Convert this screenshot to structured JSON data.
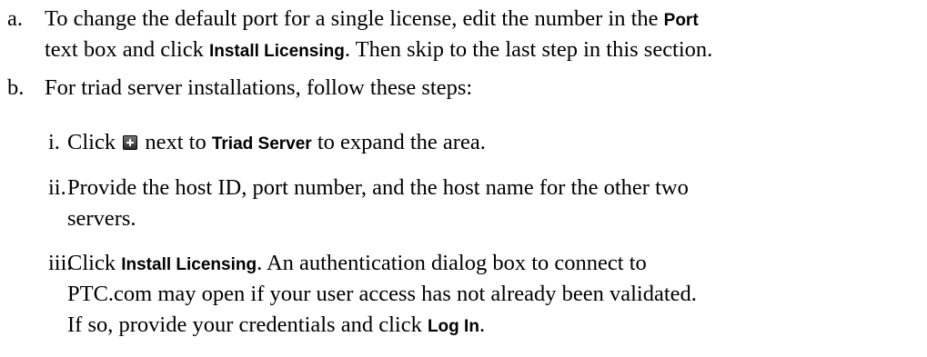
{
  "items": {
    "a": {
      "marker": "a.",
      "line1_pre": "To change the default port for a single license, edit the number in the",
      "line1_ui": "Port",
      "line2_pre": "text box and click",
      "line2_ui": "Install Licensing",
      "line2_post": ". Then skip to the last step in this section."
    },
    "b": {
      "marker": "b.",
      "line1": "For triad server installations, follow these steps:"
    },
    "i": {
      "marker": "i.",
      "pre": "Click",
      "icon": "expand-plus-icon",
      "mid": "next to",
      "ui": "Triad Server",
      "post": "to expand the area."
    },
    "ii": {
      "marker": "ii.",
      "line1": "Provide the host ID, port number, and the host name for the other two",
      "line2": "servers."
    },
    "iii": {
      "marker": "iii.",
      "line1_pre": "Click",
      "line1_ui": "Install Licensing",
      "line1_post": ". An authentication dialog box to connect to",
      "line2": "PTC.com may open if your user access has not already been validated.",
      "line3_pre": "If so, provide your credentials and click",
      "line3_ui": "Log In",
      "line3_post": "."
    }
  }
}
